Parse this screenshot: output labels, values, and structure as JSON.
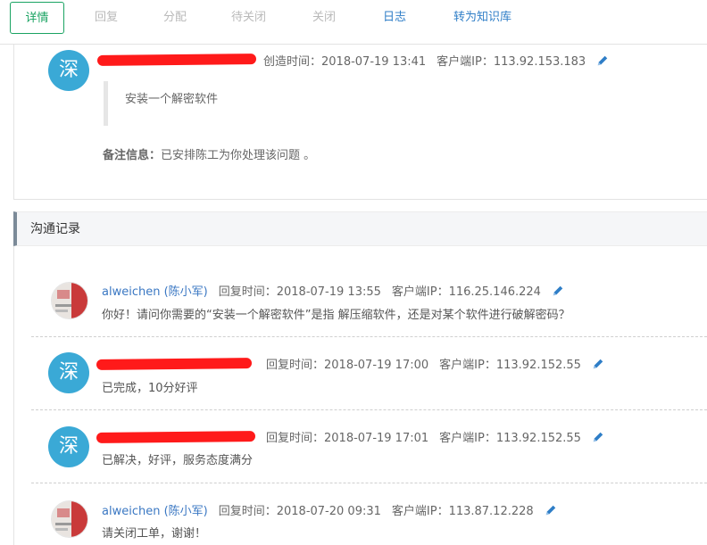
{
  "tabs": [
    {
      "label": "详情",
      "state": "active"
    },
    {
      "label": "回复",
      "state": "disabled"
    },
    {
      "label": "分配",
      "state": "disabled"
    },
    {
      "label": "待关闭",
      "state": "disabled"
    },
    {
      "label": "关闭",
      "state": "disabled"
    },
    {
      "label": "日志",
      "state": "link"
    },
    {
      "label": "转为知识库",
      "state": "link"
    }
  ],
  "ticket": {
    "avatar_text": "深",
    "created": "创造时间：2018-07-19 13:41",
    "ip": "客户端IP：113.92.153.183",
    "content": "安装一个解密软件",
    "remark_label": "备注信息：",
    "remark_text": "已安排陈工为你处理该问题 。"
  },
  "section": {
    "title": "沟通记录"
  },
  "records": [
    {
      "author": "alweichen (陈小军)",
      "time": "回复时间：2018-07-19 13:55",
      "ip": "客户端IP：116.25.146.224",
      "message": "你好！请问你需要的“安装一个解密软件”是指  解压缩软件，还是对某个软件进行破解密码？"
    },
    {
      "avatar_text": "深",
      "time": "回复时间：2018-07-19 17:00",
      "ip": "客户端IP：113.92.152.55",
      "message": "已完成，10分好评"
    },
    {
      "avatar_text": "深",
      "time": "回复时间：2018-07-19 17:01",
      "ip": "客户端IP：113.92.152.55",
      "message": "已解决，好评，服务态度满分"
    },
    {
      "author": "alweichen (陈小军)",
      "time": "回复时间：2018-07-20 09:31",
      "ip": "客户端IP：113.87.12.228",
      "message": "请关闭工单，谢谢！"
    }
  ],
  "colors": {
    "active_tab": "#1aa362",
    "link": "#2f7ec7",
    "avatar": "#3aa9d6",
    "redaction": "#ff1a1a",
    "edit_icon": "#2f7ec7"
  },
  "icons": {
    "edit": "pencil-icon"
  }
}
